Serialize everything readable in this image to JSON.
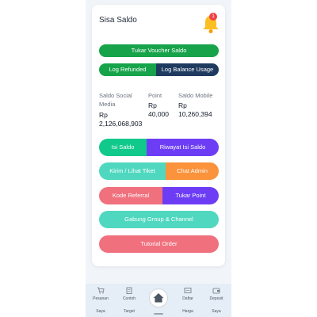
{
  "card": {
    "title": "Sisa Saldo",
    "notification_count": "1"
  },
  "buttons": {
    "tukar_voucher": "Tukar Voucher Saldo",
    "log_refunded": "Log Refunded",
    "log_balance": "Log Balance Usage",
    "isi_saldo": "Isi Saldo",
    "riwayat_isi_saldo": "Riwayat Isi Saldo",
    "kirim_tiket": "Kirim / Lihat Tiket",
    "chat_admin": "Chat Admin",
    "kode_referral": "Kode Referral",
    "tukar_point": "Tukar Point",
    "gabung_group": "Gabung Group & Channel",
    "tutorial_order": "Tutorial Order"
  },
  "balances": {
    "social_media_label_1": "Saldo Social",
    "social_media_label_2": "Media",
    "social_media_value_1": "Rp",
    "social_media_value_2": "2,126,068,903",
    "point_label": "Point",
    "point_value_1": "Rp",
    "point_value_2": "40,000",
    "mobile_label": "Saldo Mobile",
    "mobile_value_1": "Rp",
    "mobile_value_2": "10,260,394"
  },
  "nav": {
    "pesanan_1": "Pesanan",
    "pesanan_2": "Saya",
    "contoh_1": "Contoh",
    "contoh_2": "Target",
    "daftar_1": "Daftar",
    "daftar_2": "Harga",
    "deposit_1": "Deposit",
    "deposit_2": "Saya"
  },
  "colors": {
    "green": "#16a34a",
    "navy": "#1e3a5f",
    "teal_green": "#10c98a",
    "purple": "#6d3df5",
    "mint": "#4fd8bf",
    "orange": "#fb923c",
    "pink": "#f0707e",
    "bell": "#fbbf24"
  }
}
